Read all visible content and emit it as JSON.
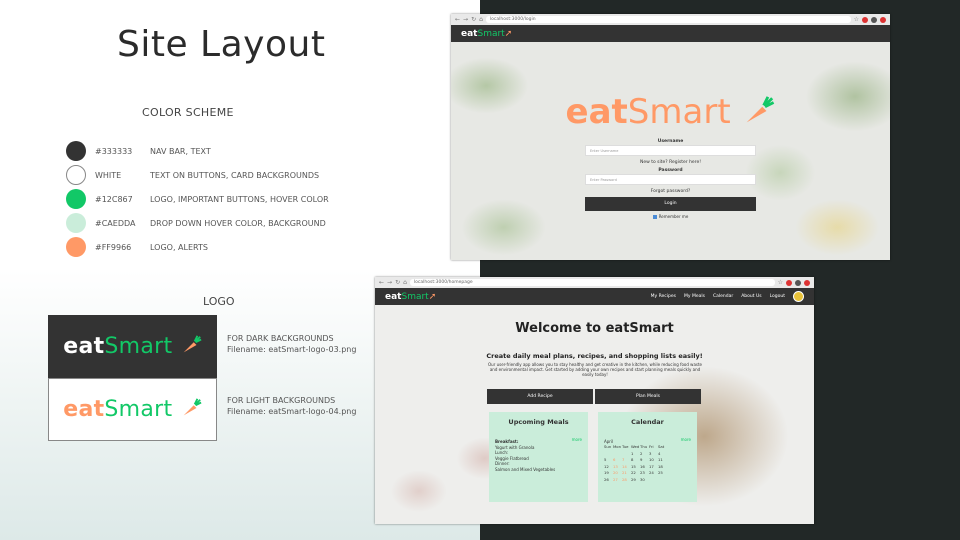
{
  "slide": {
    "title": "Site Layout"
  },
  "color_scheme": {
    "heading": "COLOR SCHEME",
    "swatches": [
      {
        "hex": "#333333",
        "label": "#333333",
        "use": "NAV BAR, TEXT"
      },
      {
        "hex": "#FFFFFF",
        "label": "WHITE",
        "use": "TEXT ON BUTTONS, CARD BACKGROUNDS"
      },
      {
        "hex": "#12C867",
        "label": "#12C867",
        "use": "LOGO, IMPORTANT BUTTONS, HOVER COLOR"
      },
      {
        "hex": "#CAEDDA",
        "label": "#CAEDDA",
        "use": "DROP DOWN HOVER COLOR, BACKGROUND"
      },
      {
        "hex": "#FF9966",
        "label": "#FF9966",
        "use": "LOGO, ALERTS"
      }
    ]
  },
  "logo": {
    "heading": "LOGO",
    "word_eat": "eat",
    "word_smart": "Smart",
    "dark_note_1": "FOR DARK BACKGROUNDS",
    "dark_note_2": "Filename: eatSmart-logo-03.png",
    "light_note_1": "FOR LIGHT BACKGROUNDS",
    "light_note_2": "Filename: eatSmart-logo-04.png"
  },
  "login_screen": {
    "url": "localhost:3000/login",
    "username_label": "Username",
    "username_placeholder": "Enter Username",
    "register_link": "New to site? Register here!",
    "password_label": "Password",
    "password_placeholder": "Enter Password",
    "forgot_link": "Forgot password?",
    "login_button": "Login",
    "remember": "Remember me"
  },
  "home_screen": {
    "url": "localhost:3000/homepage",
    "nav": [
      "My Recipes",
      "My Meals",
      "Calendar",
      "About Us",
      "Logout"
    ],
    "welcome": "Welcome to eatSmart",
    "tagline": "Create daily meal plans, recipes, and shopping lists easily!",
    "subtag": "Our user-friendly app allows you to stay healthy and get creative in the kitchen, while reducing food waste and environmental impact. Get started by adding your own recipes and start planning meals quickly and easily today!",
    "add_recipe": "Add Recipe",
    "plan_meals": "Plan Meals",
    "meals_card": {
      "title": "Upcoming Meals",
      "more": "more",
      "lines": [
        "Breakfast:",
        "Yogurt with Granola",
        "Lunch:",
        "Veggie Flatbread",
        "Dinner:",
        "Salmon and Mixed Vegetables"
      ]
    },
    "calendar_card": {
      "title": "Calendar",
      "more": "more",
      "month": "April",
      "days": [
        "Sun",
        "Mon",
        "Tue",
        "Wed",
        "Thu",
        "Fri",
        "Sat"
      ],
      "weeks": [
        [
          "",
          "",
          "",
          "1",
          "2",
          "3",
          "4"
        ],
        [
          "5",
          "6",
          "7",
          "8",
          "9",
          "10",
          "11"
        ],
        [
          "12",
          "13",
          "14",
          "15",
          "16",
          "17",
          "18"
        ],
        [
          "19",
          "20",
          "21",
          "22",
          "23",
          "24",
          "25"
        ],
        [
          "26",
          "27",
          "28",
          "29",
          "30",
          "",
          ""
        ]
      ]
    }
  }
}
